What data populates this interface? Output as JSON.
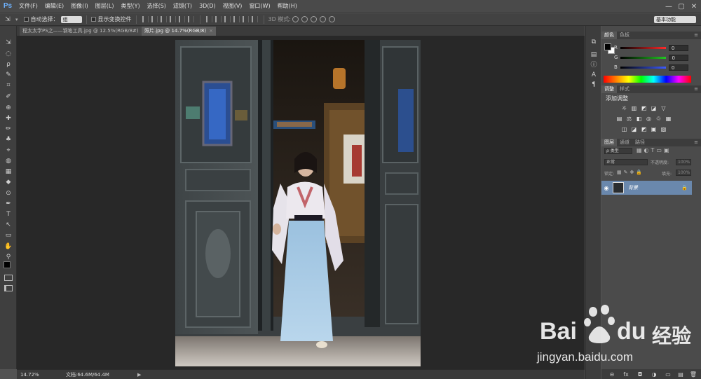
{
  "app": {
    "logo": "Ps",
    "window_controls": [
      "—",
      "▢",
      "✕"
    ],
    "menu": [
      "文件(F)",
      "编辑(E)",
      "图像(I)",
      "图层(L)",
      "类型(Y)",
      "选择(S)",
      "滤镜(T)",
      "3D(D)",
      "视图(V)",
      "窗口(W)",
      "帮助(H)"
    ]
  },
  "options_bar": {
    "auto_select_label": "自动选择：",
    "auto_select_value": "组",
    "show_transform_label": "显示变换控件",
    "mode_3d_label": "3D 模式:",
    "workspace": "基本功能"
  },
  "documents": {
    "tabs": [
      {
        "title": "程太太学PS之——钢笔工具.jpg @ 12.5%(RGB/8#)",
        "close": "×",
        "active": false
      },
      {
        "title": "照片.jpg @ 14.7%(RGB/8)",
        "close": "×",
        "active": true
      }
    ]
  },
  "status": {
    "zoom": "14.72%",
    "doc_info": "文档:64.6M/64.4M",
    "arrow": "▶"
  },
  "color_panel": {
    "tabs": [
      "颜色",
      "色板"
    ],
    "menu": "≡",
    "labels": [
      "R",
      "G",
      "B"
    ],
    "values": [
      "0",
      "0",
      "0"
    ],
    "colors": {
      "r": "#ff2a2a",
      "g": "#22c722",
      "b": "#3c5bff"
    }
  },
  "adjust_panel": {
    "tabs": [
      "调整",
      "样式"
    ],
    "menu": "≡",
    "title": "添加调整",
    "row1": [
      "☼",
      "▥",
      "◩",
      "◪",
      "▽"
    ],
    "row2": [
      "▤",
      "⚖",
      "◧",
      "◎",
      "♲",
      "▦"
    ],
    "row3": [
      "◫",
      "◪",
      "◩",
      "▣",
      "▧"
    ]
  },
  "layers_panel": {
    "tabs": [
      "图层",
      "通道",
      "路径"
    ],
    "menu": "≡",
    "filter_label": "ρ 类型",
    "blend_mode": "正常",
    "opacity_label": "不透明度:",
    "opacity_value": "100%",
    "lock_label": "锁定:",
    "fill_label": "填充:",
    "fill_value": "100%",
    "layer_name": "背景",
    "bottom_icons": [
      "⊝",
      "fx",
      "◘",
      "◑",
      "▭",
      "▤",
      "🗑"
    ]
  },
  "tools": [
    "⇲",
    "◌",
    "ρ",
    "✎",
    "⌗",
    "✐",
    "⊕",
    "✚",
    "✏",
    "♣",
    "⌖",
    "◍",
    "▦",
    "◆",
    "⊙",
    "✒",
    "T",
    "↖",
    "▭",
    "✋",
    "⚲"
  ],
  "watermark": {
    "brand": "Bai",
    "brand2": "du",
    "cn": "经验",
    "url": "jingyan.baidu.com"
  }
}
